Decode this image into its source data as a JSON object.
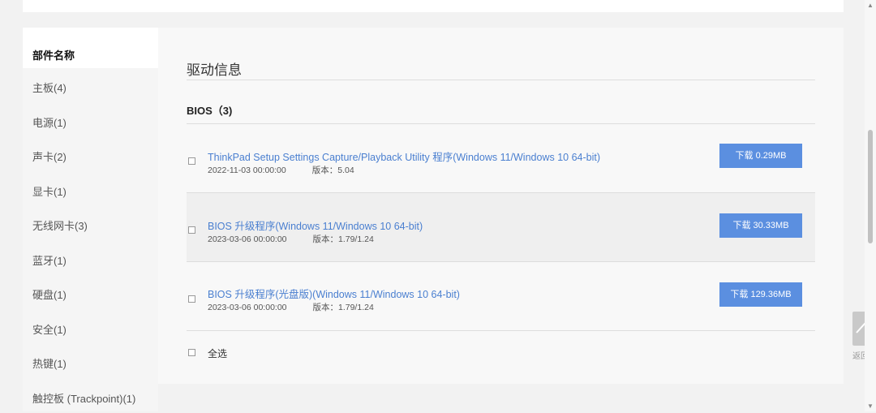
{
  "sidebar": {
    "header": "部件名称",
    "items": [
      "主板(4)",
      "电源(1)",
      "声卡(2)",
      "显卡(1)",
      "无线网卡(3)",
      "蓝牙(1)",
      "硬盘(1)",
      "安全(1)",
      "热键(1)",
      "触控板 (Trackpoint)(1)"
    ]
  },
  "main": {
    "title": "驱动信息",
    "section": "BIOS（3)",
    "select_all": "全选",
    "drivers": [
      {
        "name": "ThinkPad Setup Settings Capture/Playback Utility 程序(Windows 11/Windows 10 64-bit)",
        "date": "2022-11-03 00:00:00",
        "version": "版本：5.04",
        "download": "下载 0.29MB"
      },
      {
        "name": "BIOS 升级程序(Windows 11/Windows 10 64-bit)",
        "date": "2023-03-06 00:00:00",
        "version": "版本：1.79/1.24",
        "download": "下载 30.33MB"
      },
      {
        "name": "BIOS 升级程序(光盘版)(Windows 11/Windows 10 64-bit)",
        "date": "2023-03-06 00:00:00",
        "version": "版本：1.79/1.24",
        "download": "下载 129.36MB"
      }
    ]
  },
  "back_to_top": "返回顶部"
}
